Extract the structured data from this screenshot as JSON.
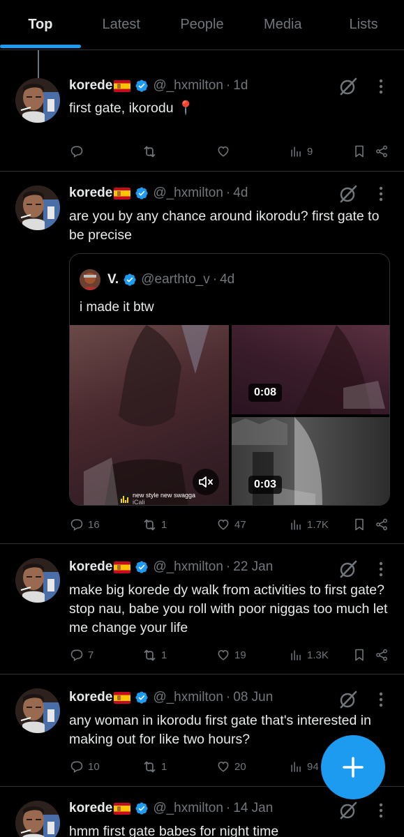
{
  "tabs": [
    {
      "label": "Top",
      "active": true
    },
    {
      "label": "Latest",
      "active": false
    },
    {
      "label": "People",
      "active": false
    },
    {
      "label": "Media",
      "active": false
    },
    {
      "label": "Lists",
      "active": false
    }
  ],
  "colors": {
    "accent": "#1d9bf0",
    "background": "#000000",
    "muted": "#71767b",
    "divider": "#2f3336"
  },
  "tweets": [
    {
      "name": "korede",
      "flag": "spain-flag",
      "handle": "@_hxmilton",
      "time": "1d",
      "text": "first gate, ikorodu 📍",
      "replies": "",
      "retweets": "",
      "likes": "",
      "views": "9"
    },
    {
      "name": "korede",
      "flag": "spain-flag",
      "handle": "@_hxmilton",
      "time": "4d",
      "text": "are you by any chance around ikorodu? first gate to be precise",
      "replies": "16",
      "retweets": "1",
      "likes": "47",
      "views": "1.7K",
      "quote": {
        "name": "V.",
        "handle": "@earthto_v",
        "time": "4d",
        "text": "i made it btw",
        "media": [
          {
            "type": "video",
            "muted": true,
            "music_label": "new style new swagga",
            "music_sub": "iCali"
          },
          {
            "type": "video",
            "duration": "0:08"
          },
          {
            "type": "video",
            "duration": "0:03"
          }
        ]
      }
    },
    {
      "name": "korede",
      "flag": "spain-flag",
      "handle": "@_hxmilton",
      "time": "22 Jan",
      "text": "make big korede dy walk from activities to first gate? stop nau, babe you roll with poor niggas too much let me change your life",
      "replies": "7",
      "retweets": "1",
      "likes": "19",
      "views": "1.3K"
    },
    {
      "name": "korede",
      "flag": "spain-flag",
      "handle": "@_hxmilton",
      "time": "08 Jun",
      "text": "any woman in ikorodu first gate that's interested in making out for like two hours?",
      "replies": "10",
      "retweets": "1",
      "likes": "20",
      "views": "94"
    },
    {
      "name": "korede",
      "flag": "spain-flag",
      "handle": "@_hxmilton",
      "time": "14 Jan",
      "text": "hmm first gate babes for night time"
    }
  ],
  "fab": {
    "icon": "plus-icon"
  }
}
